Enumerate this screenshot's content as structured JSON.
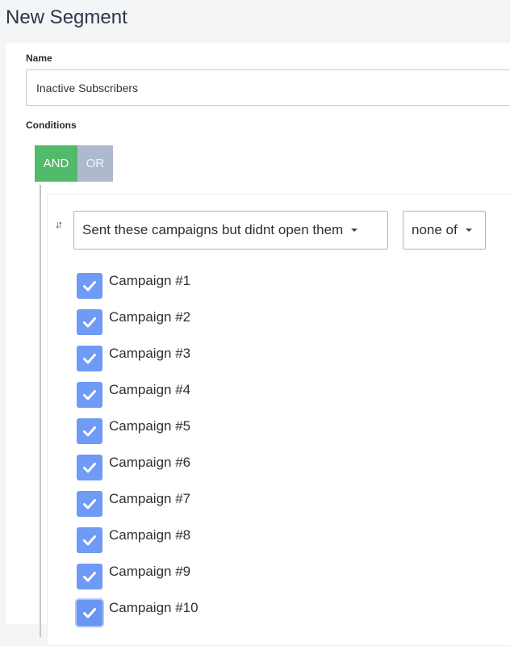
{
  "page": {
    "title": "New Segment"
  },
  "form": {
    "name_label": "Name",
    "name_value": "Inactive Subscribers",
    "conditions_label": "Conditions"
  },
  "logic": {
    "and_label": "AND",
    "or_label": "OR",
    "active": "AND",
    "active_color": "#52ba6b",
    "inactive_color": "#aeb9cf"
  },
  "condition": {
    "sort_icon": "sort-arrows-icon",
    "type_selected": "Sent these campaigns but didnt open them",
    "operator_selected": "none of",
    "checkbox_color": "#6f9af5",
    "campaigns": [
      {
        "label": "Campaign #1",
        "checked": true
      },
      {
        "label": "Campaign #2",
        "checked": true
      },
      {
        "label": "Campaign #3",
        "checked": true
      },
      {
        "label": "Campaign #4",
        "checked": true
      },
      {
        "label": "Campaign #5",
        "checked": true
      },
      {
        "label": "Campaign #6",
        "checked": true
      },
      {
        "label": "Campaign #7",
        "checked": true
      },
      {
        "label": "Campaign #8",
        "checked": true
      },
      {
        "label": "Campaign #9",
        "checked": true
      },
      {
        "label": "Campaign #10",
        "checked": true,
        "focused": true
      }
    ]
  }
}
